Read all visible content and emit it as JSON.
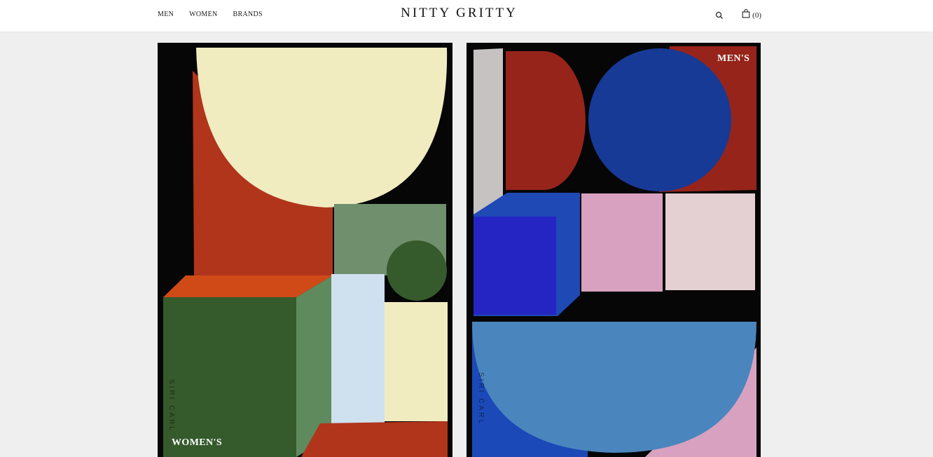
{
  "header": {
    "logo": "NITTY GRITTY",
    "nav": [
      {
        "label": "MEN"
      },
      {
        "label": "WOMEN"
      },
      {
        "label": "BRANDS"
      }
    ],
    "search_icon": "search-icon",
    "cart_icon": "shopping-bag-icon",
    "cart_count": "(0)"
  },
  "panels": {
    "womens": {
      "label": "WOMEN'S",
      "artwork_signature": "SIRI CARL"
    },
    "mens": {
      "label": "MEN'S",
      "artwork_signature": "SIRI CARL"
    }
  },
  "colors": {
    "page_bg": "#efefef",
    "header_bg": "#ffffff",
    "panel_bg": "#060606",
    "cream": "#f1ebc0",
    "rust": "#b0351a",
    "dark_green": "#355a2c",
    "sage": "#6f8f6d",
    "ice_blue": "#cfe0ef",
    "maroon": "#96241b",
    "navy": "#163a95",
    "royal_blue": "#2525c4",
    "pink": "#d8a1bf",
    "light_pink": "#e4cfd3",
    "steel_blue": "#4a86bd",
    "grey": "#c6c2c2"
  }
}
